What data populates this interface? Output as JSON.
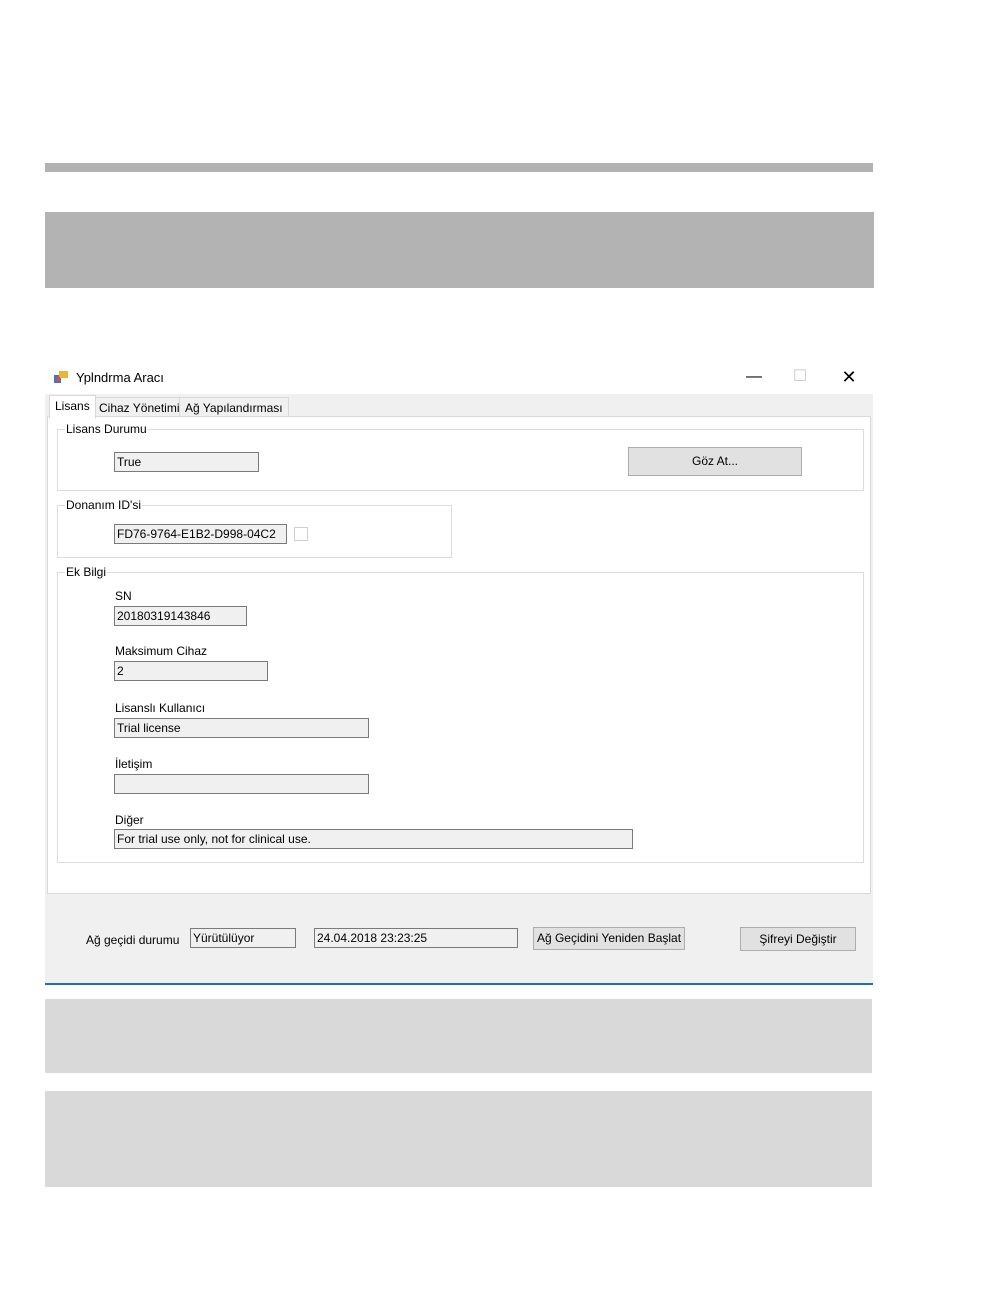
{
  "window": {
    "title": "Yplndrma Aracı",
    "minimize_glyph": "—",
    "maximize_glyph": "☐",
    "close_glyph": "✕"
  },
  "tabs": [
    "Lisans",
    "Cihaz Yönetimi",
    "Ağ Yapılandırması"
  ],
  "license_status": {
    "group_title": "Lisans Durumu",
    "value": "True",
    "browse_label": "Göz At..."
  },
  "hardware_id": {
    "group_title": "Donanım ID'si",
    "value": "FD76-9764-E1B2-D998-04C2"
  },
  "extra_info": {
    "group_title": "Ek Bilgi",
    "sn_label": "SN",
    "sn_value": "20180319143846",
    "max_devices_label": "Maksimum Cihaz",
    "max_devices_value": "2",
    "licensed_user_label": "Lisanslı Kullanıcı",
    "licensed_user_value": "Trial license",
    "contact_label": "İletişim",
    "contact_value": "",
    "other_label": "Diğer",
    "other_value": "For trial use only, not for clinical use."
  },
  "gateway": {
    "status_label": "Ağ geçidi durumu",
    "status_value": "Yürütülüyor",
    "timestamp": "24.04.2018 23:23:25",
    "restart_label": "Ağ Geçidini Yeniden Başlat",
    "change_password_label": "Şifreyi Değiştir"
  }
}
